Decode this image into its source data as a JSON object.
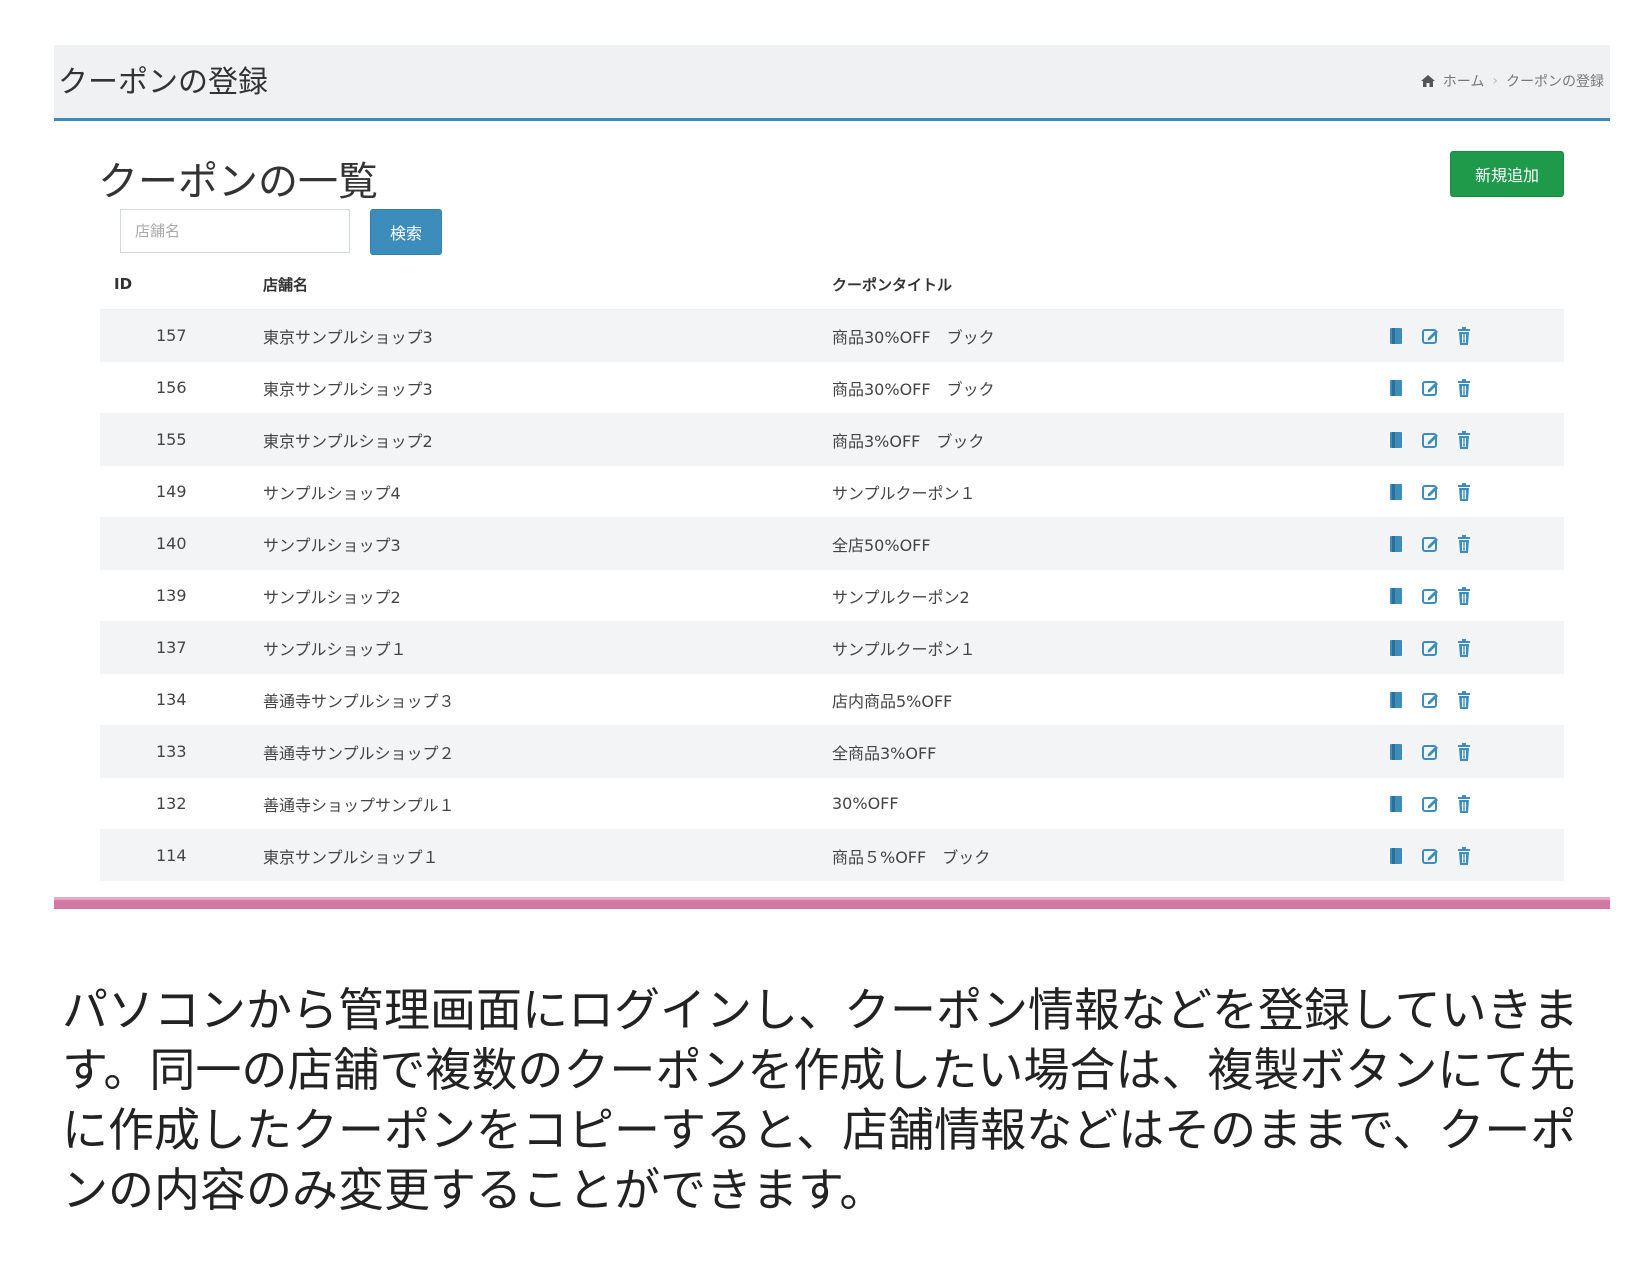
{
  "topbar": {
    "title": "クーポンの登録",
    "breadcrumb": [
      "ホーム",
      "クーポンの登録"
    ]
  },
  "main": {
    "list_title": "クーポンの一覧",
    "add_button": "新規追加",
    "search": {
      "placeholder": "店舗名",
      "value": "",
      "button": "検索"
    },
    "table": {
      "headers": [
        "ID",
        "店舗名",
        "クーポンタイトル",
        ""
      ],
      "rows": [
        {
          "id": "157",
          "shop": "東京サンプルショップ3",
          "title": "商品30%OFF　ブック"
        },
        {
          "id": "156",
          "shop": "東京サンプルショップ3",
          "title": "商品30%OFF　ブック"
        },
        {
          "id": "155",
          "shop": "東京サンプルショップ2",
          "title": "商品3%OFF　ブック"
        },
        {
          "id": "149",
          "shop": "サンプルショップ4",
          "title": "サンプルクーポン１"
        },
        {
          "id": "140",
          "shop": "サンプルショップ3",
          "title": "全店50%OFF"
        },
        {
          "id": "139",
          "shop": "サンプルショップ2",
          "title": "サンプルクーポン2"
        },
        {
          "id": "137",
          "shop": "サンプルショップ１",
          "title": "サンプルクーポン１"
        },
        {
          "id": "134",
          "shop": "善通寺サンプルショップ３",
          "title": "店内商品5%OFF"
        },
        {
          "id": "133",
          "shop": "善通寺サンプルショップ２",
          "title": "全商品3%OFF"
        },
        {
          "id": "132",
          "shop": "善通寺ショップサンプル１",
          "title": "30%OFF"
        },
        {
          "id": "114",
          "shop": "東京サンプルショップ１",
          "title": "商品５%OFF　ブック"
        }
      ],
      "action_icons": [
        "copy-icon",
        "edit-icon",
        "trash-icon"
      ]
    }
  },
  "caption": "パソコンから管理画面にログインし、クーポン情報などを登録していきます。同一の店舗で複数のクーポンを作成したい場合は、複製ボタンにて先に作成したクーポンをコピーすると、店舗情報などはそのままで、クーポンの内容のみ変更することができます。",
  "colors": {
    "accent": "#3c8dbc",
    "add_button": "#1f9a4b",
    "icon": "#3c8dbc",
    "bottom_bar": "#d27aa3"
  }
}
